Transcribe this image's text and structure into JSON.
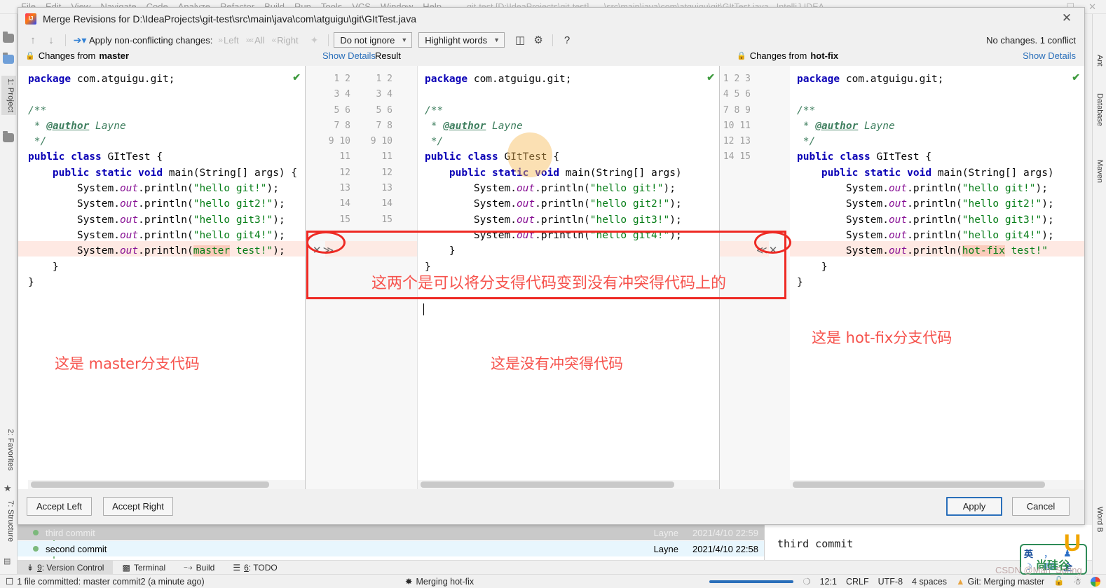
{
  "ide": {
    "menu": [
      "File",
      "Edit",
      "View",
      "Navigate",
      "Code",
      "Analyze",
      "Refactor",
      "Build",
      "Run",
      "Tools",
      "VCS",
      "Window",
      "Help"
    ],
    "window_title": "git-test [D:\\IdeaProjects\\git-test] - ...\\src\\main\\java\\com\\atguigu\\git\\GItTest.java - IntelliJ IDEA",
    "left_tabs": [
      {
        "label": "1: Project",
        "selected": true
      },
      {
        "label": "2: Favorites",
        "selected": false
      },
      {
        "label": "7: Structure",
        "selected": false
      }
    ],
    "right_tabs": [
      "Ant",
      "Database",
      "Maven",
      "Word B"
    ]
  },
  "dialog": {
    "title": "Merge Revisions for D:\\IdeaProjects\\git-test\\src\\main\\java\\com\\atguigu\\git\\GItTest.java",
    "close_label": "✕",
    "toolbar": {
      "prev_label": "↑",
      "next_label": "↓",
      "apply_all_label": "Apply non-conflicting changes:",
      "left_label": "Left",
      "all_label": "All",
      "right_label": "Right",
      "ignore_select": "Do not ignore",
      "highlight_select": "Highlight words",
      "help_label": "?",
      "status": "No changes. 1 conflict"
    },
    "panels": {
      "left_header": "Changes from",
      "left_branch": "master",
      "left_show_details": "Show Details",
      "result_header": "Result",
      "right_header": "Changes from",
      "right_branch": "hot-fix",
      "right_show_details": "Show Details"
    },
    "buttons": {
      "accept_left": "Accept Left",
      "accept_right": "Accept Right",
      "apply": "Apply",
      "cancel": "Cancel"
    }
  },
  "code": {
    "left_lines": [
      "package com.atguigu.git;",
      "",
      "/**",
      " * @author Layne",
      " */",
      "public class GItTest {",
      "    public static void main(String[] args) {",
      "        System.out.println(\"hello git!\");",
      "        System.out.println(\"hello git2!\");",
      "        System.out.println(\"hello git3!\");",
      "        System.out.println(\"hello git4!\");",
      "        System.out.println(\"master test!\");",
      "    }",
      "}"
    ],
    "mid_lines": [
      "package com.atguigu.git;",
      "",
      "/**",
      " * @author Layne",
      " */",
      "public class GItTest {",
      "    public static void main(String[] args) {",
      "        System.out.println(\"hello git!\");",
      "        System.out.println(\"hello git2!\");",
      "        System.out.println(\"hello git3!\");",
      "        System.out.println(\"hello git4!\");",
      "    }",
      "}"
    ],
    "right_lines": [
      "package com.atguigu.git;",
      "",
      "/**",
      " * @author Layne",
      " */",
      "public class GItTest {",
      "    public static void main(String[] args) {",
      "        System.out.println(\"hello git!\");",
      "        System.out.println(\"hello git2!\");",
      "        System.out.println(\"hello git3!\");",
      "        System.out.println(\"hello git4!\");",
      "        System.out.println(\"hot-fix test!\");",
      "    }",
      "}"
    ],
    "left_line_numbers": [
      "1",
      "2",
      "3",
      "4",
      "5",
      "6",
      "7",
      "8",
      "9",
      "10",
      "11",
      "12",
      "13",
      "14",
      "15"
    ],
    "mid_line_numbers": [
      "1",
      "2",
      "3",
      "4",
      "5",
      "6",
      "7",
      "8",
      "9",
      "10",
      "11",
      "12",
      "13",
      "14",
      "15"
    ],
    "right_line_numbers": [
      "1",
      "2",
      "3",
      "4",
      "5",
      "6",
      "7",
      "8",
      "9",
      "10",
      "11",
      "12",
      "13",
      "14",
      "15"
    ]
  },
  "annotations": {
    "left_note": "这是 master分支代码",
    "mid_note": "这是没有冲突得代码",
    "right_note": "这是 hot-fix分支代码",
    "box_note": "这两个是可以将分支得代码变到没有冲突得代码上的",
    "color": "#f6534d"
  },
  "gutter_actions": {
    "left_close": "✕",
    "left_apply": "≫",
    "right_apply": "≪",
    "right_close": "✕",
    "conflict_line": "12"
  },
  "vcs": {
    "commits": [
      {
        "message": "third commit",
        "author": "Layne",
        "date": "2021/4/10 22:59",
        "selected": false
      },
      {
        "message": "second commit",
        "author": "Layne",
        "date": "2021/4/10 22:58",
        "selected": true
      }
    ],
    "detail": "third commit",
    "tool_tabs": [
      {
        "num": "9",
        "label": "9: Version Control",
        "active": true
      },
      {
        "num": "",
        "label": "Terminal",
        "active": false
      },
      {
        "num": "",
        "label": "Build",
        "active": false
      },
      {
        "num": "6",
        "label": "6: TODO",
        "active": false
      }
    ]
  },
  "statusbar": {
    "left_message": "1 file committed: master commit2 (a minute ago)",
    "progress_message": "Merging hot-fix",
    "position": "12:1",
    "line_sep": "CRLF",
    "encoding": "UTF-8",
    "indent": "4 spaces",
    "git_status": "Git: Merging master"
  },
  "ime": {
    "lang": "英",
    "punct": "，",
    "moon": "☽",
    "keyboard": "⌨",
    "full": "全",
    "person": "♟"
  },
  "branding": {
    "logo_text": "尚硅谷",
    "watermark": "CSDN @Man_Spring"
  }
}
